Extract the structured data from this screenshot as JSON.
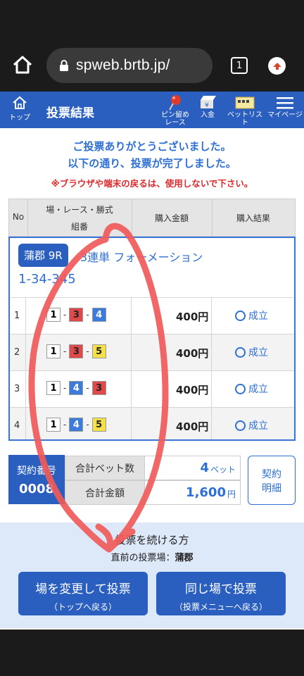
{
  "browser": {
    "url": "spweb.brtb.jp/",
    "tab_count": "1"
  },
  "header": {
    "top_label": "トップ",
    "title": "投票結果",
    "pin_label_1": "ピン留め",
    "pin_label_2": "レース",
    "deposit_label": "入金",
    "betlist_label": "ベットリスト",
    "mypage_label": "マイページ"
  },
  "message": {
    "line1": "ご投票ありがとうございました。",
    "line2": "以下の通り、投票が完了しました。",
    "warning": "※ブラウザや端末の戻るは、使用しないで下さい。"
  },
  "table": {
    "col_no": "No",
    "col_race_1": "場・レース・勝式",
    "col_race_2": "組番",
    "col_amount": "購入金額",
    "col_result": "購入結果",
    "race_badge": "蒲郡 9R",
    "race_type": "3連単 フォーメーション",
    "combination": "1-34-345",
    "rows": [
      {
        "no": "1",
        "b1": "1",
        "b2": "3",
        "b3": "4",
        "amount": "400円",
        "result": "成立"
      },
      {
        "no": "2",
        "b1": "1",
        "b2": "3",
        "b3": "5",
        "amount": "400円",
        "result": "成立"
      },
      {
        "no": "3",
        "b1": "1",
        "b2": "4",
        "b3": "3",
        "amount": "400円",
        "result": "成立"
      },
      {
        "no": "4",
        "b1": "1",
        "b2": "4",
        "b3": "5",
        "amount": "400円",
        "result": "成立"
      }
    ],
    "dash": "-"
  },
  "summary": {
    "contract_label": "契約番号",
    "contract_no": "0008",
    "bet_count_label": "合計ベット数",
    "bet_count": "4",
    "bet_unit": "ベット",
    "total_label": "合計金額",
    "total": "1,600",
    "total_unit": "円",
    "detail_line1": "契約",
    "detail_line2": "明細"
  },
  "continue": {
    "title": "投票を続ける方",
    "prev_label": "直前の投票場：",
    "prev_venue": "蒲郡",
    "btn_change_main": "場を変更して投票",
    "btn_change_sub": "（トップへ戻る）",
    "btn_same_main": "同じ場で投票",
    "btn_same_sub": "（投票メニューへ戻る）"
  },
  "colors": {
    "brand": "#2a5fc0",
    "accent_text": "#2e6fd4",
    "warning": "#e0292c",
    "boat_1": "#ffffff",
    "boat_3": "#e0484a",
    "boat_4": "#3a7bdc",
    "boat_5": "#f5e04a",
    "annotation": "#f05a5a"
  }
}
